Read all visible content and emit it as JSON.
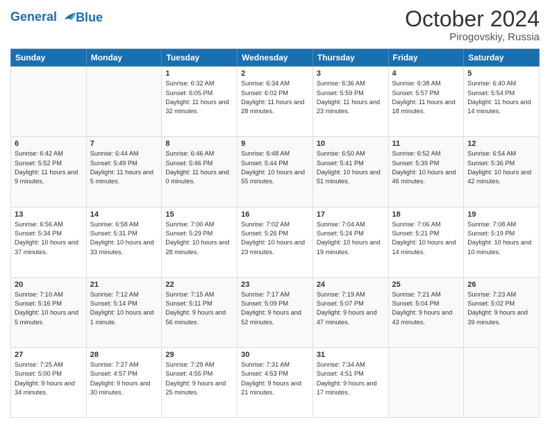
{
  "header": {
    "logo_line1": "General",
    "logo_line2": "Blue",
    "month_title": "October 2024",
    "location": "Pirogovskiy, Russia"
  },
  "weekdays": [
    "Sunday",
    "Monday",
    "Tuesday",
    "Wednesday",
    "Thursday",
    "Friday",
    "Saturday"
  ],
  "weeks": [
    [
      {
        "day": "",
        "sunrise": "",
        "sunset": "",
        "daylight": ""
      },
      {
        "day": "",
        "sunrise": "",
        "sunset": "",
        "daylight": ""
      },
      {
        "day": "1",
        "sunrise": "Sunrise: 6:32 AM",
        "sunset": "Sunset: 6:05 PM",
        "daylight": "Daylight: 11 hours and 32 minutes."
      },
      {
        "day": "2",
        "sunrise": "Sunrise: 6:34 AM",
        "sunset": "Sunset: 6:02 PM",
        "daylight": "Daylight: 11 hours and 28 minutes."
      },
      {
        "day": "3",
        "sunrise": "Sunrise: 6:36 AM",
        "sunset": "Sunset: 5:59 PM",
        "daylight": "Daylight: 11 hours and 23 minutes."
      },
      {
        "day": "4",
        "sunrise": "Sunrise: 6:38 AM",
        "sunset": "Sunset: 5:57 PM",
        "daylight": "Daylight: 11 hours and 18 minutes."
      },
      {
        "day": "5",
        "sunrise": "Sunrise: 6:40 AM",
        "sunset": "Sunset: 5:54 PM",
        "daylight": "Daylight: 11 hours and 14 minutes."
      }
    ],
    [
      {
        "day": "6",
        "sunrise": "Sunrise: 6:42 AM",
        "sunset": "Sunset: 5:52 PM",
        "daylight": "Daylight: 11 hours and 9 minutes."
      },
      {
        "day": "7",
        "sunrise": "Sunrise: 6:44 AM",
        "sunset": "Sunset: 5:49 PM",
        "daylight": "Daylight: 11 hours and 5 minutes."
      },
      {
        "day": "8",
        "sunrise": "Sunrise: 6:46 AM",
        "sunset": "Sunset: 5:46 PM",
        "daylight": "Daylight: 11 hours and 0 minutes."
      },
      {
        "day": "9",
        "sunrise": "Sunrise: 6:48 AM",
        "sunset": "Sunset: 5:44 PM",
        "daylight": "Daylight: 10 hours and 55 minutes."
      },
      {
        "day": "10",
        "sunrise": "Sunrise: 6:50 AM",
        "sunset": "Sunset: 5:41 PM",
        "daylight": "Daylight: 10 hours and 51 minutes."
      },
      {
        "day": "11",
        "sunrise": "Sunrise: 6:52 AM",
        "sunset": "Sunset: 5:39 PM",
        "daylight": "Daylight: 10 hours and 46 minutes."
      },
      {
        "day": "12",
        "sunrise": "Sunrise: 6:54 AM",
        "sunset": "Sunset: 5:36 PM",
        "daylight": "Daylight: 10 hours and 42 minutes."
      }
    ],
    [
      {
        "day": "13",
        "sunrise": "Sunrise: 6:56 AM",
        "sunset": "Sunset: 5:34 PM",
        "daylight": "Daylight: 10 hours and 37 minutes."
      },
      {
        "day": "14",
        "sunrise": "Sunrise: 6:58 AM",
        "sunset": "Sunset: 5:31 PM",
        "daylight": "Daylight: 10 hours and 33 minutes."
      },
      {
        "day": "15",
        "sunrise": "Sunrise: 7:00 AM",
        "sunset": "Sunset: 5:29 PM",
        "daylight": "Daylight: 10 hours and 28 minutes."
      },
      {
        "day": "16",
        "sunrise": "Sunrise: 7:02 AM",
        "sunset": "Sunset: 5:26 PM",
        "daylight": "Daylight: 10 hours and 23 minutes."
      },
      {
        "day": "17",
        "sunrise": "Sunrise: 7:04 AM",
        "sunset": "Sunset: 5:24 PM",
        "daylight": "Daylight: 10 hours and 19 minutes."
      },
      {
        "day": "18",
        "sunrise": "Sunrise: 7:06 AM",
        "sunset": "Sunset: 5:21 PM",
        "daylight": "Daylight: 10 hours and 14 minutes."
      },
      {
        "day": "19",
        "sunrise": "Sunrise: 7:08 AM",
        "sunset": "Sunset: 5:19 PM",
        "daylight": "Daylight: 10 hours and 10 minutes."
      }
    ],
    [
      {
        "day": "20",
        "sunrise": "Sunrise: 7:10 AM",
        "sunset": "Sunset: 5:16 PM",
        "daylight": "Daylight: 10 hours and 5 minutes."
      },
      {
        "day": "21",
        "sunrise": "Sunrise: 7:12 AM",
        "sunset": "Sunset: 5:14 PM",
        "daylight": "Daylight: 10 hours and 1 minute."
      },
      {
        "day": "22",
        "sunrise": "Sunrise: 7:15 AM",
        "sunset": "Sunset: 5:11 PM",
        "daylight": "Daylight: 9 hours and 56 minutes."
      },
      {
        "day": "23",
        "sunrise": "Sunrise: 7:17 AM",
        "sunset": "Sunset: 5:09 PM",
        "daylight": "Daylight: 9 hours and 52 minutes."
      },
      {
        "day": "24",
        "sunrise": "Sunrise: 7:19 AM",
        "sunset": "Sunset: 5:07 PM",
        "daylight": "Daylight: 9 hours and 47 minutes."
      },
      {
        "day": "25",
        "sunrise": "Sunrise: 7:21 AM",
        "sunset": "Sunset: 5:04 PM",
        "daylight": "Daylight: 9 hours and 43 minutes."
      },
      {
        "day": "26",
        "sunrise": "Sunrise: 7:23 AM",
        "sunset": "Sunset: 5:02 PM",
        "daylight": "Daylight: 9 hours and 39 minutes."
      }
    ],
    [
      {
        "day": "27",
        "sunrise": "Sunrise: 7:25 AM",
        "sunset": "Sunset: 5:00 PM",
        "daylight": "Daylight: 9 hours and 34 minutes."
      },
      {
        "day": "28",
        "sunrise": "Sunrise: 7:27 AM",
        "sunset": "Sunset: 4:57 PM",
        "daylight": "Daylight: 9 hours and 30 minutes."
      },
      {
        "day": "29",
        "sunrise": "Sunrise: 7:29 AM",
        "sunset": "Sunset: 4:55 PM",
        "daylight": "Daylight: 9 hours and 25 minutes."
      },
      {
        "day": "30",
        "sunrise": "Sunrise: 7:31 AM",
        "sunset": "Sunset: 4:53 PM",
        "daylight": "Daylight: 9 hours and 21 minutes."
      },
      {
        "day": "31",
        "sunrise": "Sunrise: 7:34 AM",
        "sunset": "Sunset: 4:51 PM",
        "daylight": "Daylight: 9 hours and 17 minutes."
      },
      {
        "day": "",
        "sunrise": "",
        "sunset": "",
        "daylight": ""
      },
      {
        "day": "",
        "sunrise": "",
        "sunset": "",
        "daylight": ""
      }
    ]
  ]
}
